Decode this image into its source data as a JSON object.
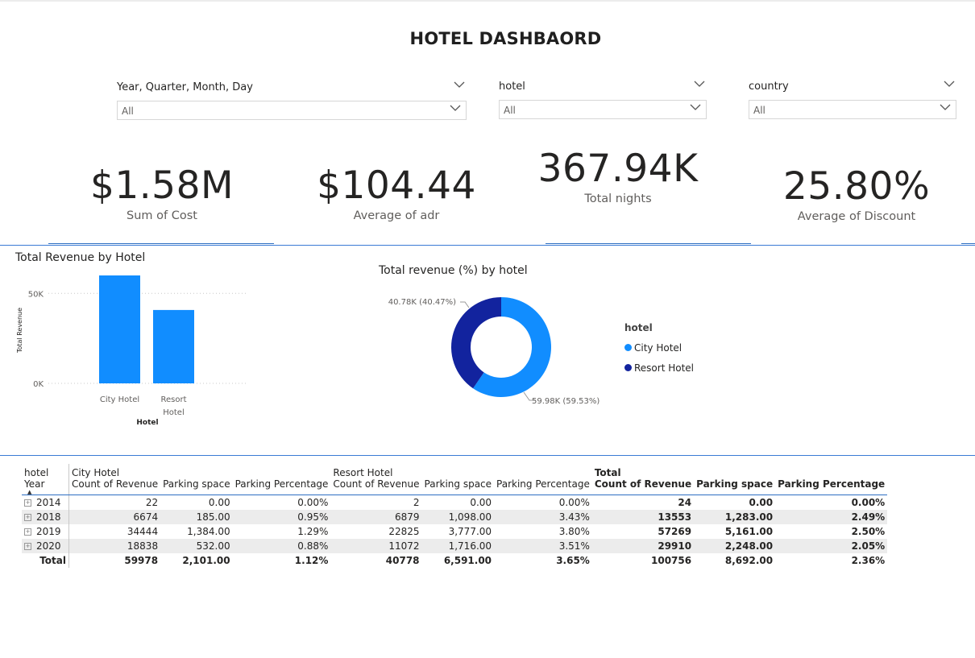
{
  "title": "HOTEL DASHBAORD",
  "slicers": [
    {
      "label": "Year, Quarter, Month, Day",
      "value": "All"
    },
    {
      "label": "hotel",
      "value": "All"
    },
    {
      "label": "country",
      "value": "All"
    }
  ],
  "kpis": [
    {
      "value": "$1.58M",
      "label": "Sum of Cost"
    },
    {
      "value": "$104.44",
      "label": "Average of adr"
    },
    {
      "value": "367.94K",
      "label": "Total nights"
    },
    {
      "value": "25.80%",
      "label": "Average of Discount"
    }
  ],
  "bar_visual": {
    "title": "Total Revenue by Hotel"
  },
  "donut_visual": {
    "title": "Total revenue (%) by hotel",
    "legend_title": "hotel"
  },
  "colors": {
    "city": "#118dff",
    "resort": "#12239e",
    "accent": "#2d6ec2"
  },
  "chart_data": [
    {
      "type": "bar",
      "title": "Total Revenue by Hotel",
      "xlabel": "Hotel",
      "ylabel": "Total Revenue",
      "categories": [
        "City Hotel",
        "Resort Hotel"
      ],
      "category_lines": [
        [
          "City Hotel"
        ],
        [
          "Resort",
          "Hotel"
        ]
      ],
      "values": [
        59978,
        40778
      ],
      "ylim": [
        0,
        59978
      ],
      "yticks": [
        {
          "value": 0,
          "label": "0K"
        },
        {
          "value": 50000,
          "label": "50K"
        }
      ]
    },
    {
      "type": "pie",
      "title": "Total revenue (%) by hotel",
      "series": [
        {
          "name": "City Hotel",
          "value": 59978,
          "label": "59.98K (59.53%)"
        },
        {
          "name": "Resort Hotel",
          "value": 40778,
          "label": "40.78K (40.47%)"
        }
      ]
    }
  ],
  "matrix": {
    "row_header": "hotel",
    "row_header2": "Year",
    "groups": [
      "City Hotel",
      "Resort Hotel",
      "Total"
    ],
    "columns": [
      "Count of Revenue",
      "Parking space",
      "Parking Percentage"
    ],
    "rows": [
      {
        "year": "2014",
        "city": [
          "22",
          "0.00",
          "0.00%"
        ],
        "resort": [
          "2",
          "0.00",
          "0.00%"
        ],
        "total": [
          "24",
          "0.00",
          "0.00%"
        ]
      },
      {
        "year": "2018",
        "city": [
          "6674",
          "185.00",
          "0.95%"
        ],
        "resort": [
          "6879",
          "1,098.00",
          "3.43%"
        ],
        "total": [
          "13553",
          "1,283.00",
          "2.49%"
        ]
      },
      {
        "year": "2019",
        "city": [
          "34444",
          "1,384.00",
          "1.29%"
        ],
        "resort": [
          "22825",
          "3,777.00",
          "3.80%"
        ],
        "total": [
          "57269",
          "5,161.00",
          "2.50%"
        ]
      },
      {
        "year": "2020",
        "city": [
          "18838",
          "532.00",
          "0.88%"
        ],
        "resort": [
          "11072",
          "1,716.00",
          "3.51%"
        ],
        "total": [
          "29910",
          "2,248.00",
          "2.05%"
        ]
      }
    ],
    "total_row": {
      "label": "Total",
      "city": [
        "59978",
        "2,101.00",
        "1.12%"
      ],
      "resort": [
        "40778",
        "6,591.00",
        "3.65%"
      ],
      "total": [
        "100756",
        "8,692.00",
        "2.36%"
      ]
    }
  }
}
